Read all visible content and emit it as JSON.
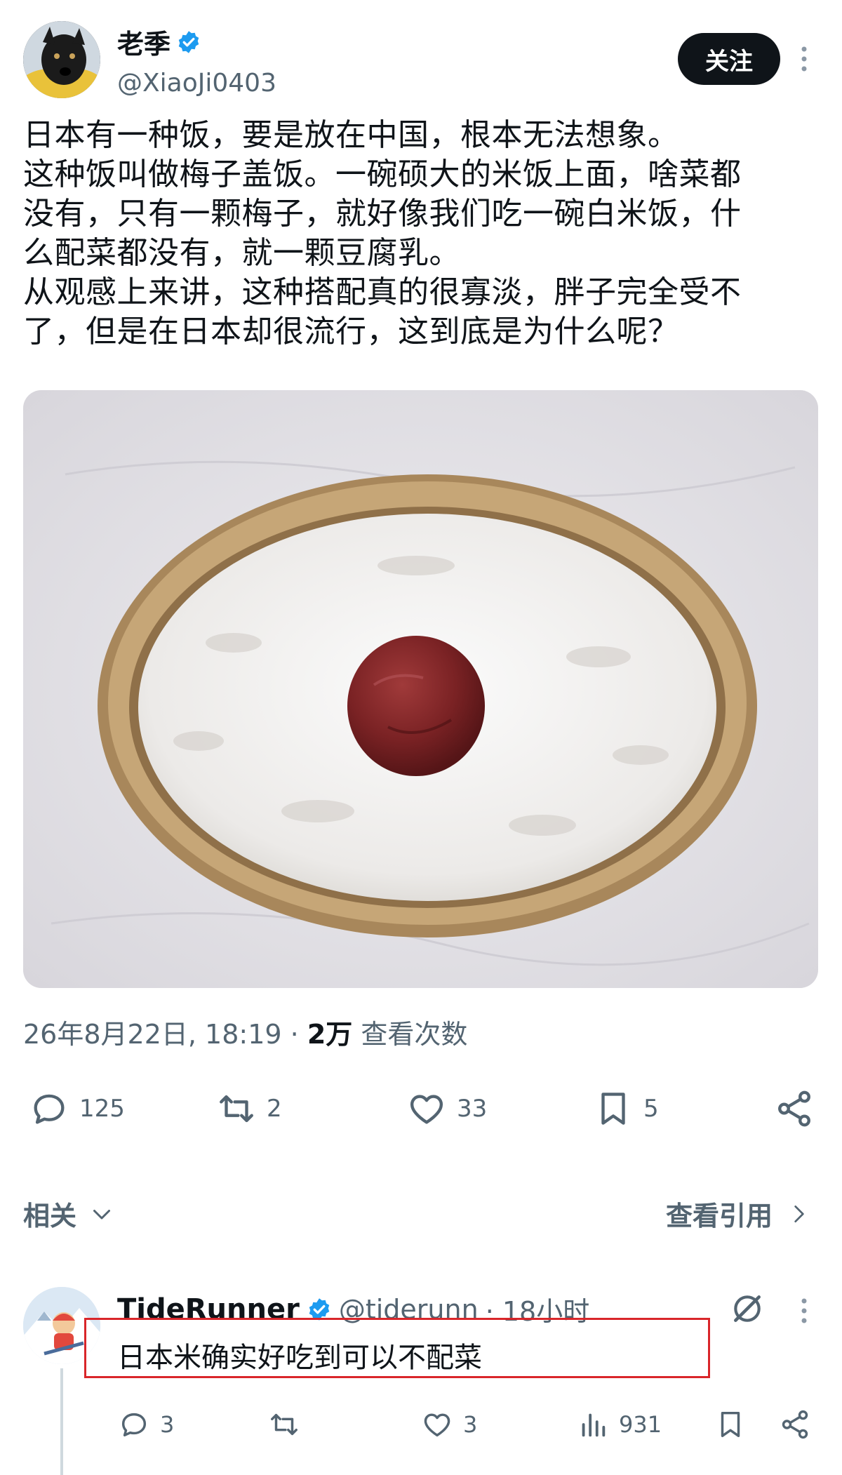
{
  "author": {
    "name": "老季",
    "handle": "@XiaoJi0403",
    "verified": true
  },
  "follow_label": "关注",
  "post": {
    "lines": [
      "日本有一种饭，要是放在中国，根本无法想象。",
      "这种饭叫做梅子盖饭。一碗硕大的米饭上面，啥菜都",
      "没有，只有一颗梅子，就好像我们吃一碗白米饭，什",
      "么配菜都没有，就一颗豆腐乳。",
      "从观感上来讲，这种搭配真的很寡淡，胖子完全受不",
      "了，但是在日本却很流行，这到底是为什么呢？"
    ]
  },
  "meta": {
    "timestamp": "26年8月22日, 18:19",
    "separator": "·",
    "views": "2万",
    "views_label": "查看次数"
  },
  "actions": {
    "replies": "125",
    "retweets": "2",
    "likes": "33",
    "bookmarks": "5"
  },
  "related_label": "相关",
  "quotes_label": "查看引用",
  "reply": {
    "name": "TideRunner",
    "handle": "@tiderunn",
    "time": "· 18小时",
    "text": "日本米确实好吃到可以不配菜",
    "replies": "3",
    "likes": "3",
    "views": "931"
  },
  "colors": {
    "accent": "#1d9bf0",
    "text": "#0f1419",
    "muted": "#536471",
    "highlight": "#d9262a"
  }
}
